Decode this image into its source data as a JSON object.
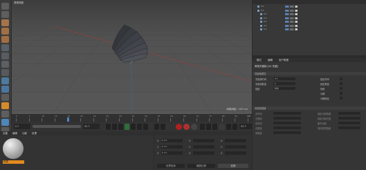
{
  "viewport": {
    "label": "透视视图",
    "grid_info": "网格间距 : 100 cm"
  },
  "object_manager": {
    "rows": [
      {
        "name": "0.1",
        "indent": 0
      },
      {
        "name": "0.1",
        "indent": 0
      },
      {
        "name": "0.1",
        "indent": 1
      },
      {
        "name": "0.1",
        "indent": 1
      },
      {
        "name": "0.1",
        "indent": 1
      },
      {
        "name": "0.1",
        "indent": 1
      },
      {
        "name": "0.1",
        "indent": 1
      }
    ]
  },
  "attributes": {
    "menu": [
      "模式",
      "编辑",
      "用户数据"
    ],
    "object_title": "简易关键帧 [24 关键]",
    "section": "关键帧属性",
    "rows": [
      {
        "label": "关键帧时间",
        "value": "0 F"
      },
      {
        "label": "关键帧数值",
        "value": "0"
      },
      {
        "label": "插值",
        "value": "样条"
      }
    ],
    "right_rows": [
      "锁定时间",
      "锁定数值",
      "静音",
      "分解",
      "分解颜色"
    ],
    "section2": "关键帧插值",
    "rows2": [
      "左时间",
      "左数值",
      "右时间",
      "右数值",
      "零角度"
    ],
    "right_rows2": [
      "锁定切线角度",
      "锁定切线长度",
      "断开切线",
      "保持视觉角度"
    ]
  },
  "timeline": {
    "ticks": [
      "0",
      "5",
      "10",
      "15",
      "20",
      "25",
      "30",
      "35",
      "40",
      "45",
      "50",
      "55",
      "60",
      "65",
      "70",
      "75",
      "80",
      "85",
      "90"
    ],
    "end_frame": "0 F"
  },
  "transport": {
    "start": "0 F",
    "end": "90 F",
    "current": "90 F"
  },
  "material": {
    "menu": [
      "创建",
      "编辑",
      "功能",
      "纹理"
    ],
    "mat_label": "材质"
  },
  "coordinates": {
    "fields": [
      "X",
      "Y",
      "Z"
    ],
    "values": [
      "0 cm",
      "0 cm",
      "0 cm"
    ],
    "buttons": [
      "世界坐标",
      "缩放比例",
      "应用"
    ]
  }
}
